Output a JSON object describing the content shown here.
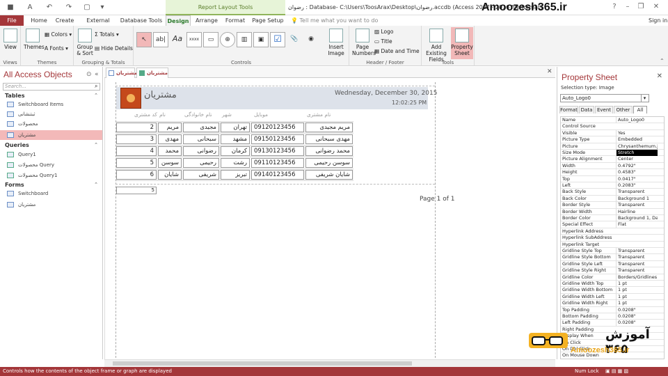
{
  "titlebar": {
    "context_label": "Report Layout Tools",
    "window_title": "رضوان : Database- C:\\Users\\ToosArax\\Desktop\\رضوان.accdb (Access 2007 - 2016 file format)",
    "brand": "Amoozesh365.ir"
  },
  "tabs": {
    "file": "File",
    "home": "Home",
    "create": "Create",
    "external": "External Data",
    "dbtools": "Database Tools",
    "design": "Design",
    "arrange": "Arrange",
    "format": "Format",
    "pagesetup": "Page Setup",
    "tellme": "Tell me what you want to do",
    "signin": "Sign in"
  },
  "ribbon": {
    "views": {
      "view": "View",
      "label": "Views"
    },
    "themes": {
      "themes": "Themes",
      "colors": "Colors",
      "fonts": "Fonts",
      "label": "Themes"
    },
    "grouping": {
      "group_sort": "Group & Sort",
      "totals": "Totals",
      "hide_details": "Hide Details",
      "label": "Grouping & Totals"
    },
    "controls": {
      "label": "Controls",
      "insert_image": "Insert Image",
      "textbox": "ab|",
      "label_ctl": "Aa",
      "button": "xxxx"
    },
    "header_footer": {
      "page_numbers": "Page Numbers",
      "logo": "Logo",
      "title": "Title",
      "date_time": "Date and Time",
      "label": "Header / Footer"
    },
    "tools": {
      "add_fields": "Add Existing Fields",
      "property_sheet": "Property Sheet",
      "label": "Tools"
    }
  },
  "nav": {
    "title": "All Access Objects",
    "search_placeholder": "Search...",
    "sections": [
      {
        "name": "Tables",
        "items": [
          "Switchboard Items",
          "ثبتنشانی",
          "محصولات",
          "مشتریان"
        ]
      },
      {
        "name": "Queries",
        "items": [
          "Query1",
          "محصولات Query",
          "محصولات Query1"
        ]
      },
      {
        "name": "Forms",
        "items": [
          "Switchboard",
          "مشتریان"
        ]
      }
    ]
  },
  "doctabs": [
    "مشتریان",
    "مشتریان"
  ],
  "report": {
    "title": "مشتریان",
    "date": "Wednesday, December 30, 2015",
    "time": "12:02:25 PM",
    "columns": [
      "کد مشتری",
      "نام",
      "نام خانوادگی",
      "شهر",
      "موبایل",
      "نام مشتری"
    ],
    "rows": [
      {
        "id": "2",
        "fname": "مریم",
        "lname": "مجیدی",
        "city": "تهران",
        "mobile": "09120123456",
        "full": "مریم مجیدی"
      },
      {
        "id": "3",
        "fname": "مهدی",
        "lname": "سبحانی",
        "city": "مشهد",
        "mobile": "09150123456",
        "full": "مهدی سبحانی"
      },
      {
        "id": "4",
        "fname": "محمد",
        "lname": "رضوانی",
        "city": "کرمان",
        "mobile": "09130123456",
        "full": "محمد رضوانی"
      },
      {
        "id": "5",
        "fname": "سوسن",
        "lname": "رحیمی",
        "city": "رشت",
        "mobile": "09110123456",
        "full": "سوسن رحیمی"
      },
      {
        "id": "6",
        "fname": "شایان",
        "lname": "شریفی",
        "city": "تبریز",
        "mobile": "09140123456",
        "full": "شایان شریفی"
      }
    ],
    "count": "5",
    "page": "Page 1 of 1"
  },
  "props": {
    "title": "Property Sheet",
    "selection_type": "Selection type:  Image",
    "selected": "Auto_Logo0",
    "tabs": [
      "Format",
      "Data",
      "Event",
      "Other",
      "All"
    ],
    "rows": [
      [
        "Name",
        "Auto_Logo0"
      ],
      [
        "Control Source",
        ""
      ],
      [
        "Visible",
        "Yes"
      ],
      [
        "Picture Type",
        "Embedded"
      ],
      [
        "Picture",
        "Chrysanthemum.jp"
      ],
      [
        "Size Mode",
        "Stretch"
      ],
      [
        "Picture Alignment",
        "Center"
      ],
      [
        "Width",
        "0.4792\""
      ],
      [
        "Height",
        "0.4583\""
      ],
      [
        "Top",
        "0.0417\""
      ],
      [
        "Left",
        "0.2083\""
      ],
      [
        "Back Style",
        "Transparent"
      ],
      [
        "Back Color",
        "Background 1"
      ],
      [
        "Border Style",
        "Transparent"
      ],
      [
        "Border Width",
        "Hairline"
      ],
      [
        "Border Color",
        "Background 1, Dar"
      ],
      [
        "Special Effect",
        "Flat"
      ],
      [
        "Hyperlink Address",
        ""
      ],
      [
        "Hyperlink SubAddress",
        ""
      ],
      [
        "Hyperlink Target",
        ""
      ],
      [
        "Gridline Style Top",
        "Transparent"
      ],
      [
        "Gridline Style Bottom",
        "Transparent"
      ],
      [
        "Gridline Style Left",
        "Transparent"
      ],
      [
        "Gridline Style Right",
        "Transparent"
      ],
      [
        "Gridline Color",
        "Borders/Gridlines"
      ],
      [
        "Gridline Width Top",
        "1 pt"
      ],
      [
        "Gridline Width Bottom",
        "1 pt"
      ],
      [
        "Gridline Width Left",
        "1 pt"
      ],
      [
        "Gridline Width Right",
        "1 pt"
      ],
      [
        "Top Padding",
        "0.0208\""
      ],
      [
        "Bottom Padding",
        "0.0208\""
      ],
      [
        "Left Padding",
        "0.0208\""
      ],
      [
        "Right Padding",
        ""
      ],
      [
        "Display When",
        ""
      ],
      [
        "On Click",
        ""
      ],
      [
        "On Dbl Click",
        ""
      ],
      [
        "On Mouse Down",
        ""
      ]
    ]
  },
  "status": {
    "message": "Controls how the contents of the object frame or graph are displayed",
    "numlock": "Num Lock"
  },
  "watermark": {
    "text": "آموزش ۳۶۵",
    "url": "Amoozesh365.ir"
  },
  "colors": {
    "accent": "#a4373a",
    "context": "#8fb45a",
    "selected_nav": "#f3b9b9"
  }
}
